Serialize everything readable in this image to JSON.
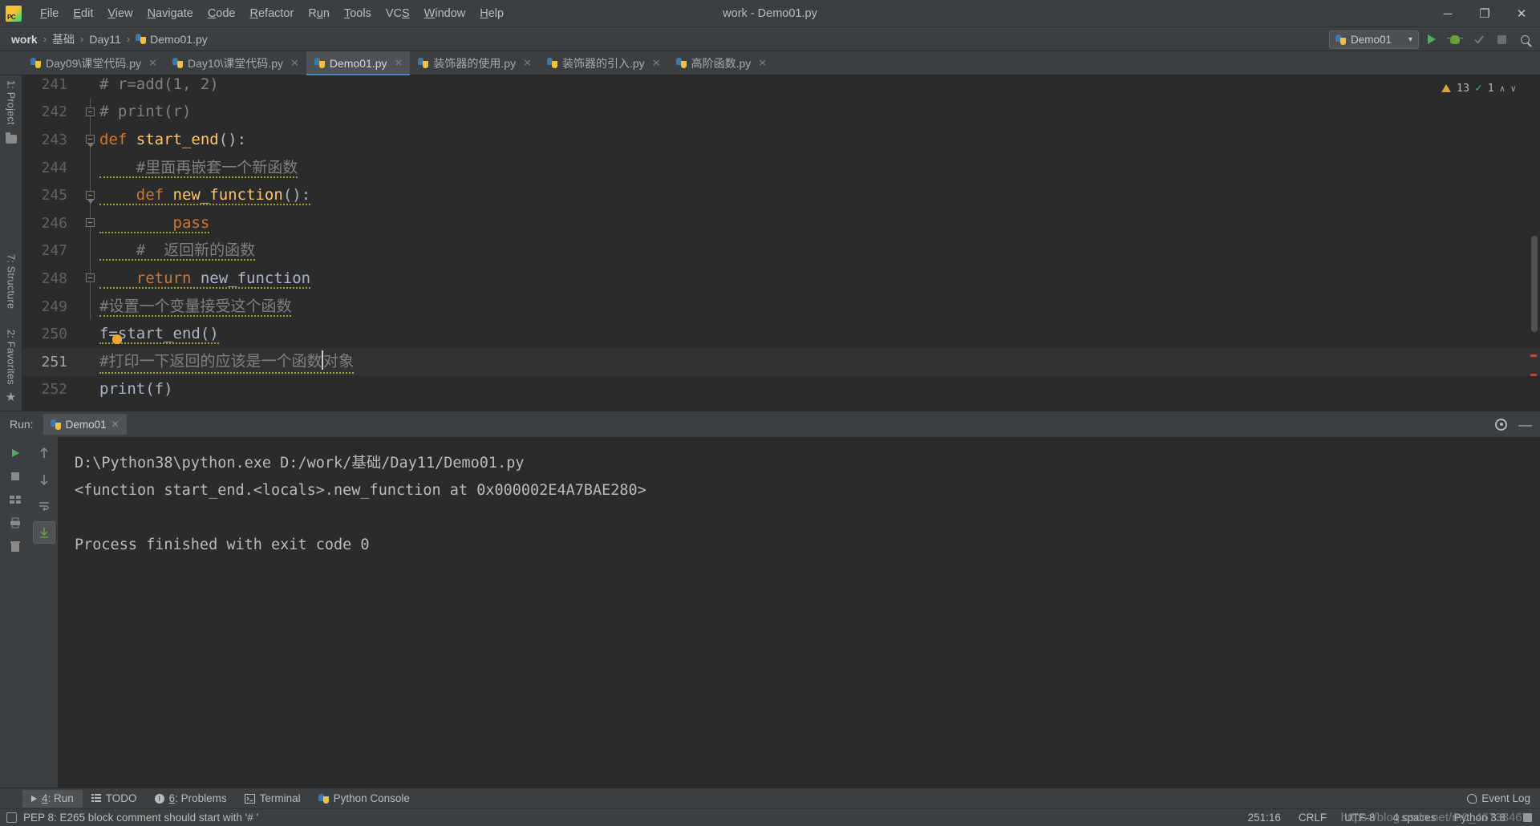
{
  "window": {
    "title": "work - Demo01.py",
    "logo_icon": "pycharm-logo-icon",
    "minimize_glyph": "─",
    "maximize_glyph": "❐",
    "close_glyph": "✕"
  },
  "menu": [
    {
      "label": "File",
      "accel": "F"
    },
    {
      "label": "Edit",
      "accel": "E"
    },
    {
      "label": "View",
      "accel": "V"
    },
    {
      "label": "Navigate",
      "accel": "N"
    },
    {
      "label": "Code",
      "accel": "C"
    },
    {
      "label": "Refactor",
      "accel": "R"
    },
    {
      "label": "Run",
      "accel": "u"
    },
    {
      "label": "Tools",
      "accel": "T"
    },
    {
      "label": "VCS",
      "accel": "S"
    },
    {
      "label": "Window",
      "accel": "W"
    },
    {
      "label": "Help",
      "accel": "H"
    }
  ],
  "breadcrumb": {
    "separator": "›",
    "items": [
      "work",
      "基础",
      "Day11",
      "Demo01.py"
    ]
  },
  "toolbar": {
    "run_config": "Demo01",
    "chevron": "▾",
    "run_label": "Run",
    "debug_label": "Debug",
    "coverage_label": "Run with Coverage",
    "stop_label": "Stop",
    "search_label": "Search Everywhere"
  },
  "editor_tabs": [
    {
      "label": "Day09\\课堂代码.py",
      "active": false,
      "close": "✕"
    },
    {
      "label": "Day10\\课堂代码.py",
      "active": false,
      "close": "✕"
    },
    {
      "label": "Demo01.py",
      "active": true,
      "close": "✕"
    },
    {
      "label": "装饰器的使用.py",
      "active": false,
      "close": "✕"
    },
    {
      "label": "装饰器的引入.py",
      "active": false,
      "close": "✕"
    },
    {
      "label": "高阶函数.py",
      "active": false,
      "close": "✕"
    }
  ],
  "left_tool_tabs": [
    {
      "label": "1: Project"
    },
    {
      "label": "7: Structure"
    },
    {
      "label": "2: Favorites"
    }
  ],
  "inspection": {
    "warning_count": "13",
    "ok_count": "1",
    "up_glyph": "∧",
    "down_glyph": "∨"
  },
  "code": {
    "lines": [
      {
        "num": "241",
        "segments": [
          {
            "t": "# r=add(1, 2)",
            "c": "cm"
          }
        ],
        "indent": 0,
        "partial": true
      },
      {
        "num": "242",
        "segments": [
          {
            "t": "# print(r)",
            "c": "cm"
          }
        ],
        "indent": 0,
        "fold": "minus"
      },
      {
        "num": "243",
        "segments": [
          {
            "t": "def ",
            "c": "kw"
          },
          {
            "t": "start_end",
            "c": "fn"
          },
          {
            "t": "():",
            "c": "pl"
          }
        ],
        "indent": 0,
        "fold": "arrow"
      },
      {
        "num": "244",
        "segments": [
          {
            "t": "    #里面再嵌套一个新函数",
            "c": "cm"
          }
        ],
        "indent": 0,
        "squiggle": true
      },
      {
        "num": "245",
        "segments": [
          {
            "t": "    ",
            "c": "pl"
          },
          {
            "t": "def ",
            "c": "kw"
          },
          {
            "t": "new_function",
            "c": "fn"
          },
          {
            "t": "():",
            "c": "pl"
          }
        ],
        "indent": 0,
        "fold": "arrow",
        "squiggle": true
      },
      {
        "num": "246",
        "segments": [
          {
            "t": "        ",
            "c": "pl"
          },
          {
            "t": "pass",
            "c": "kw"
          }
        ],
        "indent": 0,
        "fold": "minus",
        "squiggle": true
      },
      {
        "num": "247",
        "segments": [
          {
            "t": "    #  返回新的函数",
            "c": "cm"
          }
        ],
        "indent": 0,
        "squiggle": true
      },
      {
        "num": "248",
        "segments": [
          {
            "t": "    ",
            "c": "pl"
          },
          {
            "t": "return ",
            "c": "kw"
          },
          {
            "t": "new_function",
            "c": "pl"
          }
        ],
        "indent": 0,
        "fold": "minus",
        "squiggle": true
      },
      {
        "num": "249",
        "segments": [
          {
            "t": "#设置一个变量接受这个函数",
            "c": "cm"
          }
        ],
        "indent": 0,
        "squiggle": true
      },
      {
        "num": "250",
        "segments": [
          {
            "t": "f=start_end()",
            "c": "pl"
          }
        ],
        "indent": 0,
        "squiggle": true,
        "bulb": true
      },
      {
        "num": "251",
        "segments": [
          {
            "t": "#打印一下返回的应该是一个函数",
            "c": "cm"
          }
        ],
        "caret": true,
        "caret_tail": "对象",
        "current": true,
        "squiggle": true
      },
      {
        "num": "252",
        "segments": [
          {
            "t": "print",
            "c": "pl"
          },
          {
            "t": "(f)",
            "c": "pl"
          }
        ],
        "indent": 0
      }
    ]
  },
  "run_panel": {
    "label": "Run:",
    "tab_label": "Demo01",
    "tab_close": "✕",
    "settings_label": "Settings",
    "hide_label": "Hide",
    "console_lines": [
      "D:\\Python38\\python.exe D:/work/基础/Day11/Demo01.py",
      "<function start_end.<locals>.new_function at 0x000002E4A7BAE280>",
      "",
      "Process finished with exit code 0"
    ]
  },
  "tool_windows": [
    {
      "label": "4: Run",
      "accel": "4",
      "icon": "play-icon",
      "active": true
    },
    {
      "label": "TODO",
      "icon": "list-icon",
      "active": false
    },
    {
      "label": "6: Problems",
      "accel": "6",
      "icon": "warning-icon",
      "active": false
    },
    {
      "label": "Terminal",
      "icon": "terminal-icon",
      "active": false
    },
    {
      "label": "Python Console",
      "icon": "python-icon",
      "active": false
    }
  ],
  "event_log": {
    "label": "Event Log",
    "icon": "bell-icon"
  },
  "status": {
    "message": "PEP 8: E265 block comment should start with '# '",
    "caret_position": "251:16",
    "line_separator": "CRLF",
    "encoding": "UTF-8",
    "indent": "4 spaces",
    "interpreter": "Python 3.8",
    "lock_icon": "lock-icon"
  },
  "watermark": "https://blog.csdn.net/m0_46738467",
  "colors": {
    "background": "#3c3f41",
    "editor_bg": "#2b2b2b",
    "keyword": "#cc7832",
    "function": "#ffc66d",
    "comment": "#808080",
    "plain": "#a9b7c6",
    "accent": "#4a88c7",
    "warning": "#bbb529",
    "ok": "#59a869"
  }
}
